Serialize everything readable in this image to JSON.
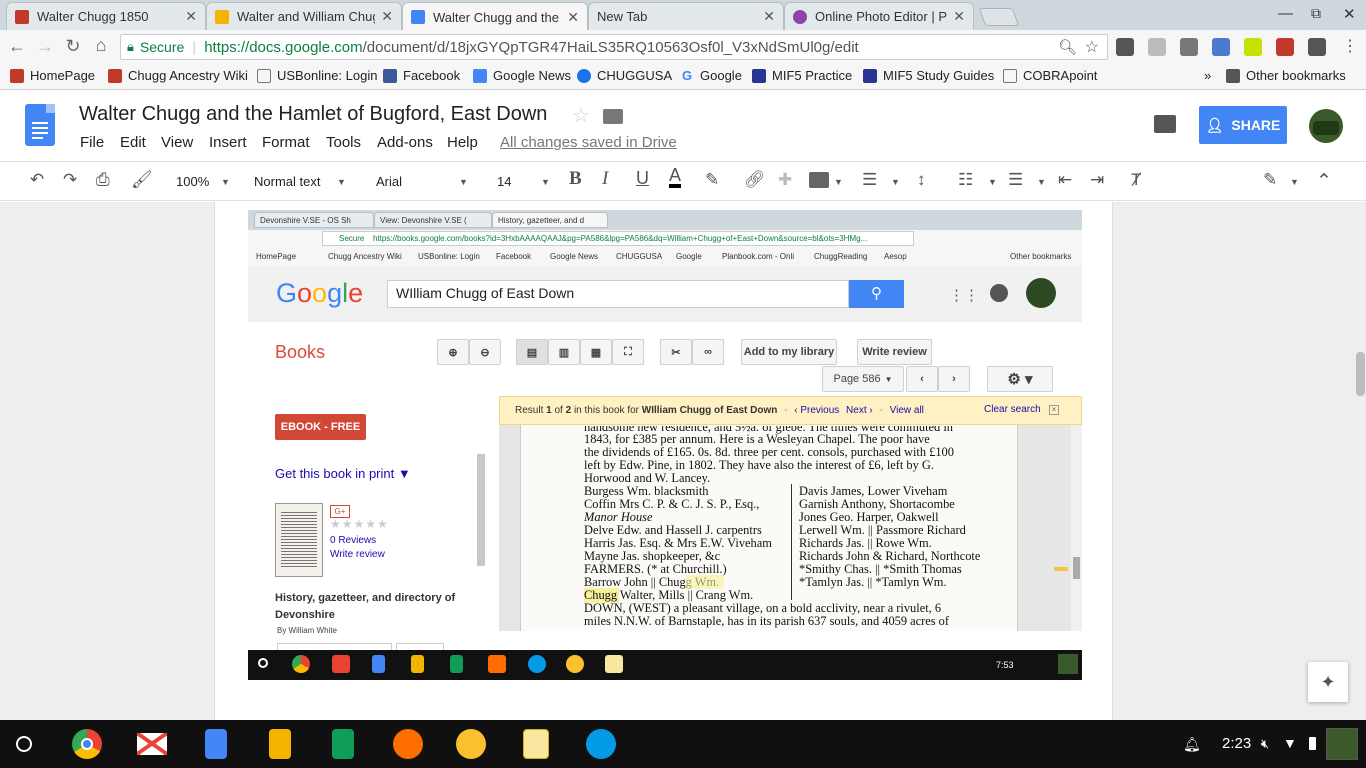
{
  "browser": {
    "tabs": [
      {
        "title": "Walter Chugg 1850",
        "fav": "#c0392b"
      },
      {
        "title": "Walter and William Chug",
        "fav": "#f4b400"
      },
      {
        "title": "Walter Chugg and the Ha",
        "fav": "#4285f4"
      },
      {
        "title": "New Tab",
        "fav": ""
      },
      {
        "title": "Online Photo Editor | Pix",
        "fav": "#8e44ad"
      }
    ],
    "secure_label": "Secure",
    "url_host": "https://docs.google.com",
    "url_path": "/document/d/18jxGYQpTGR47HaiLS35RQ10563Osf0l_V3xNdSmUl0g/edit",
    "bookmarks": [
      "HomePage",
      "Chugg Ancestry Wiki",
      "USBonline: Login",
      "Facebook",
      "Google News",
      "CHUGGUSA",
      "Google",
      "MIF5 Practice",
      "MIF5 Study Guides",
      "COBRApoint"
    ],
    "other_bookmarks": "Other bookmarks",
    "overflow": "»"
  },
  "doc": {
    "title": "Walter Chugg and the Hamlet of Bugford, East Down",
    "menus": [
      "File",
      "Edit",
      "View",
      "Insert",
      "Format",
      "Tools",
      "Add-ons",
      "Help"
    ],
    "saved_status": "All changes saved in Drive",
    "share_label": "SHARE",
    "zoom": "100%",
    "style": "Normal text",
    "font": "Arial",
    "size": "14"
  },
  "embedded": {
    "tabs": [
      "Devonshire V.SE - OS Sh",
      "View: Devonshire V.SE (",
      "History, gazetteer, and d"
    ],
    "secure": "Secure",
    "url": "https://books.google.com/books?id=3HxbAAAAQAAJ&pg=PA586&lpg=PA586&dq=William+Chugg+of+East+Down&source=bl&ots=3HMg...",
    "bookmarks": [
      "HomePage",
      "Chugg Ancestry Wiki",
      "USBonline: Login",
      "Facebook",
      "Google News",
      "CHUGGUSA",
      "Google",
      "Planbook.com - Onli",
      "ChuggReading",
      "Aesop"
    ],
    "other_bookmarks": "Other bookmarks",
    "search_query": "WIlliam Chugg of East Down",
    "books_label": "Books",
    "add_library": "Add to my library",
    "write_review": "Write review",
    "page_label": "Page 586",
    "ebook": "EBOOK - FREE",
    "get_print": "Get this book in print ▼",
    "reviews": "0 Reviews",
    "write_review_link": "Write review",
    "book_title": "History, gazetteer, and directory of Devonshire",
    "author": "By William White",
    "result_prefix": "Result",
    "result_n": "1",
    "result_of": "of",
    "result_total": "2",
    "result_mid": "in this book for",
    "result_query": "WIlliam Chugg of East Down",
    "prev": "‹ Previous",
    "next": "Next ›",
    "view_all": "View all",
    "clear": "Clear search",
    "shelf_time": "7:53"
  },
  "book_text": [
    "handsome new residence, and 5½a. of glebe.  The tithes were commuted in",
    "1843, for £385 per annum.  Here is a Wesleyan Chapel.  The poor have",
    "the dividends of £165. 0s. 8d. three per cent. consols, purchased with £100",
    "left by Edw. Pine, in 1802.  They have also the interest of £6, left by G.",
    "Horwood and W. Lancey."
  ],
  "book_left": [
    "Burgess Wm. blacksmith",
    "Coffin Mrs C. P. & C. J. S. P., Esq.,",
    "    Manor House",
    "Delve Edw. and Hassell J. carpentrs",
    "Harris Jas. Esq. & Mrs E.W. Viveham",
    "Mayne Jas. shopkeeper, &c",
    "   FARMERS.   (* at Churchill.)",
    "Barrow John  ||  Chugg Wm.",
    "Chugg Walter, Mills || Crang Wm."
  ],
  "book_right": [
    "Davis James, Lower Viveham",
    "Garnish Anthony, Shortacombe",
    "Jones Geo. Harper, Oakwell",
    "Lerwell Wm.  ||  Passmore Richard",
    "Richards Jas.  ||  Rowe Wm.",
    "Richards John & Richard, Northcote",
    "*Smithy Chas.  ||  *Smith Thomas",
    "*Tamlyn Jas.  ||  *Tamlyn Wm."
  ],
  "book_after": [
    "   DOWN, (WEST) a pleasant village, on a bold acclivity, near a rivulet, 6",
    "miles N.N.W. of Barnstaple, has in its parish 637 souls, and 4059 acres of"
  ],
  "system": {
    "time": "2:23"
  }
}
